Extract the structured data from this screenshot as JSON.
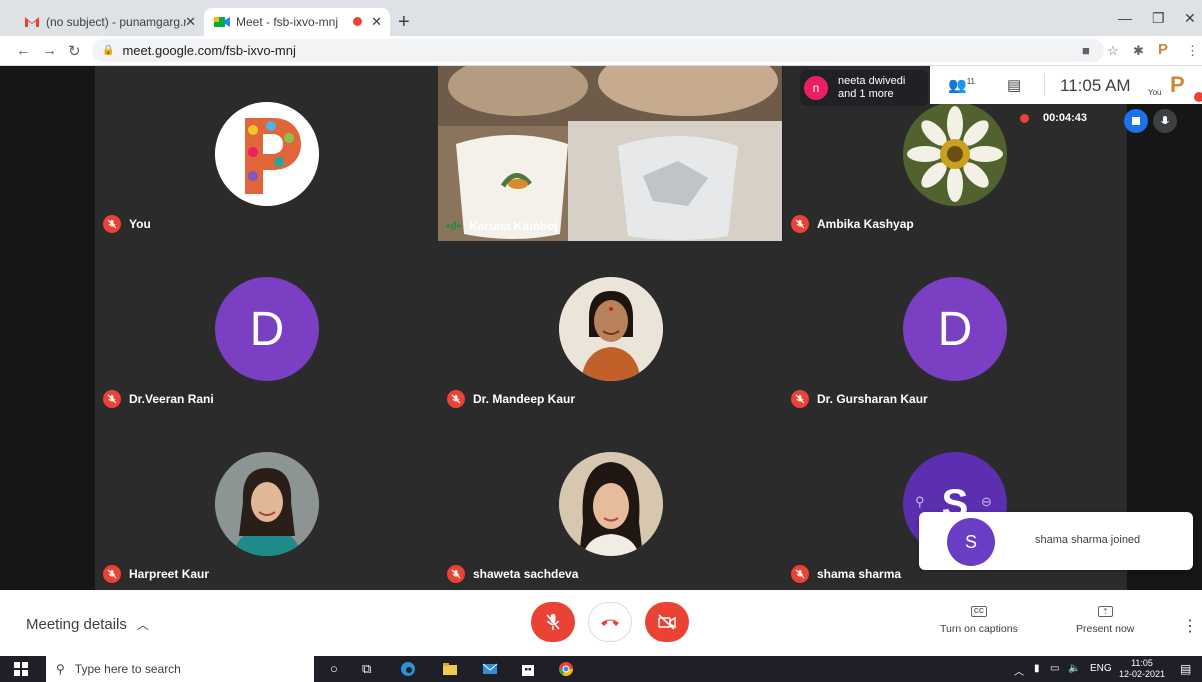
{
  "browser": {
    "tabs": [
      {
        "title": "(no subject) - punamgarg.mac@",
        "active": false
      },
      {
        "title": "Meet - fsb-ixvo-mnj",
        "active": true
      }
    ],
    "url": "meet.google.com/fsb-ixvo-mnj"
  },
  "meet": {
    "presenter": {
      "initial": "n",
      "line1": "neeta dwivedi",
      "line2": "and 1 more"
    },
    "participant_count": "11",
    "clock": "11:05 AM",
    "self_label": "You",
    "recording_time": "00:04:43",
    "tiles": [
      {
        "name": "You",
        "avatar_letter": "P"
      },
      {
        "name": "Karuna Kamboj",
        "avatar_letter": ""
      },
      {
        "name": "Ambika Kashyap",
        "avatar_letter": ""
      },
      {
        "name": "Dr.Veeran Rani",
        "avatar_letter": "D"
      },
      {
        "name": "Dr. Mandeep Kaur",
        "avatar_letter": ""
      },
      {
        "name": "Dr. Gursharan Kaur",
        "avatar_letter": "D"
      },
      {
        "name": "Harpreet Kaur",
        "avatar_letter": ""
      },
      {
        "name": "shaweta sachdeva",
        "avatar_letter": ""
      },
      {
        "name": "shama sharma",
        "avatar_letter": "S"
      }
    ],
    "toast": {
      "avatar_letter": "S",
      "message": "shama sharma joined"
    },
    "controls": {
      "meeting_details": "Meeting details",
      "captions": "Turn on captions",
      "present": "Present now"
    }
  },
  "taskbar": {
    "search_placeholder": "Type here to search",
    "lang": "ENG",
    "time": "11:05",
    "date": "12-02-2021"
  },
  "colors": {
    "mute_red": "#ea4335",
    "meet_bg": "#202124",
    "avatar_purple": "#7b3fc4"
  }
}
